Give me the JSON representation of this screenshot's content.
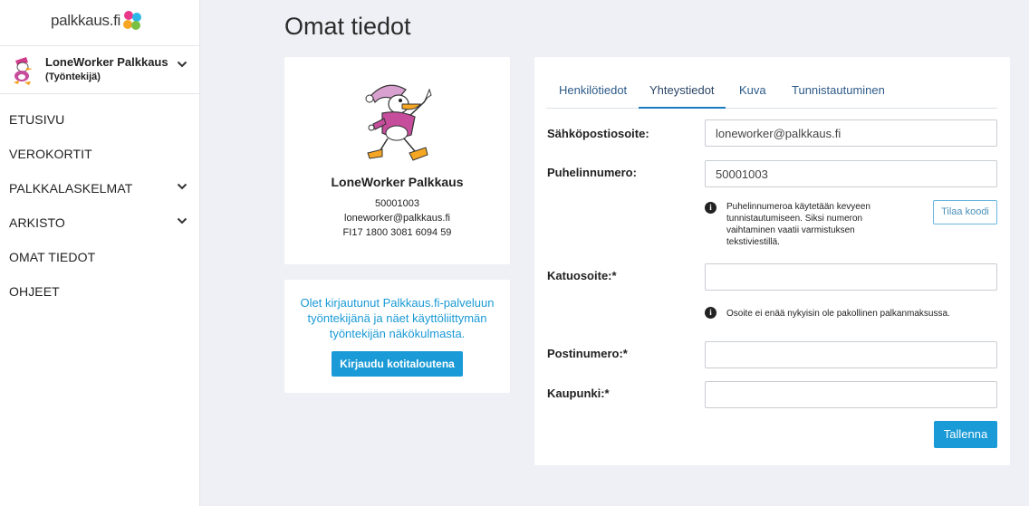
{
  "brand": {
    "logo_text": "palkkaus.fi"
  },
  "user": {
    "name": "LoneWorker Palkkaus",
    "role": "(Työntekijä)"
  },
  "nav": [
    {
      "label": "ETUSIVU",
      "has_chevron": false
    },
    {
      "label": "VEROKORTIT",
      "has_chevron": false
    },
    {
      "label": "PALKKALASKELMAT",
      "has_chevron": true
    },
    {
      "label": "ARKISTO",
      "has_chevron": true
    },
    {
      "label": "OMAT TIEDOT",
      "has_chevron": false
    },
    {
      "label": "OHJEET",
      "has_chevron": false
    }
  ],
  "page": {
    "title": "Omat tiedot"
  },
  "profile": {
    "name": "LoneWorker Palkkaus",
    "phone": "50001003",
    "email": "loneworker@palkkaus.fi",
    "iban": "FI17 1800 3081 6094 59"
  },
  "info": {
    "text": "Olet kirjautunut Palkkaus.fi-palveluun työntekijänä ja näet käyttöliittymän työntekijän näkökulmasta.",
    "button": "Kirjaudu kotitaloutena"
  },
  "tabs": [
    {
      "label": "Henkilötiedot",
      "active": false
    },
    {
      "label": "Yhteystiedot",
      "active": true
    },
    {
      "label": "Kuva",
      "active": false
    },
    {
      "label": "Tunnistautuminen",
      "active": false
    }
  ],
  "form": {
    "email_label": "Sähköpostiosoite:",
    "email_value": "loneworker@palkkaus.fi",
    "phone_label": "Puhelinnumero:",
    "phone_value": "50001003",
    "phone_hint_lines": [
      "Puhelinnumeroa käytetään kevyeen",
      "tunnistautumiseen. Siksi numeron",
      "vaihtaminen vaatii varmistuksen",
      "tekstiviestillä."
    ],
    "order_code_button": "Tilaa koodi",
    "street_label": "Katuosoite:*",
    "street_value": "",
    "street_hint": "Osoite ei enää nykyisin ole pakollinen palkanmaksussa.",
    "postal_label": "Postinumero:*",
    "postal_value": "",
    "city_label": "Kaupunki:*",
    "city_value": "",
    "save_button": "Tallenna"
  },
  "colors": {
    "accent": "#1a9ad6",
    "page_bg": "#eef0f5",
    "tab_active_border": "#1a7bc1"
  }
}
